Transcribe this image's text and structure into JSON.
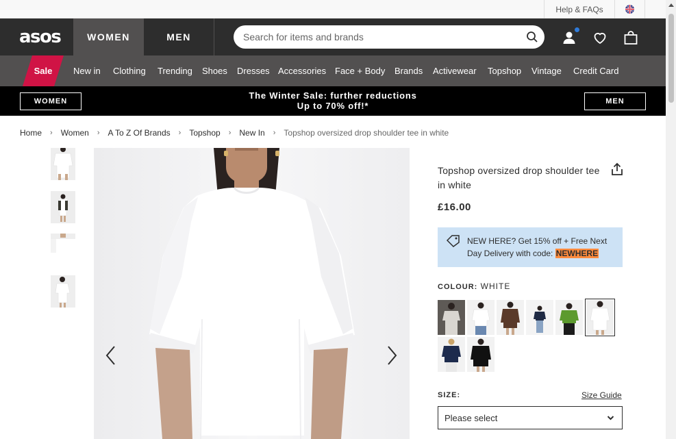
{
  "utility": {
    "help": "Help & FAQs",
    "flag": "UK flag"
  },
  "header": {
    "logo": "asos",
    "tabs": [
      "WOMEN",
      "MEN"
    ],
    "search_placeholder": "Search for items and brands"
  },
  "nav": {
    "sale": "Sale",
    "items": [
      "New in",
      "Clothing",
      "Trending",
      "Shoes",
      "Dresses",
      "Accessories",
      "Face + Body",
      "Brands",
      "Activewear",
      "Topshop",
      "Vintage",
      "Credit Card"
    ]
  },
  "promo": {
    "left_button": "WOMEN",
    "right_button": "MEN",
    "line1": "The Winter Sale: further reductions",
    "line2": "Up to 70% off!*"
  },
  "breadcrumb": [
    "Home",
    "Women",
    "A To Z Of Brands",
    "Topshop",
    "New In",
    "Topshop oversized drop shoulder tee in white"
  ],
  "product": {
    "title": "Topshop oversized drop shoulder tee in white",
    "price": "£16.00",
    "promo_text": "NEW HERE? Get 15% off + Free Next Day Delivery with code:",
    "promo_code": "NEWHERE",
    "colour_label": "COLOUR:",
    "colour_value": "WHITE",
    "size_label": "SIZE:",
    "size_guide": "Size Guide",
    "size_placeholder": "Please select"
  },
  "swatch_colors": [
    "#d9d6d1",
    "#ffffff",
    "#5a3a2a",
    "#1f2a44",
    "#5c9a2e",
    "#ffffff",
    "#1d2b4d",
    "#111111"
  ],
  "colors": {
    "header_bg": "#2d2d2d",
    "nav_bg": "#525050",
    "sale_red": "#d01345",
    "promo_blue": "#cde2f5",
    "code_orange": "#ff8b3d"
  }
}
